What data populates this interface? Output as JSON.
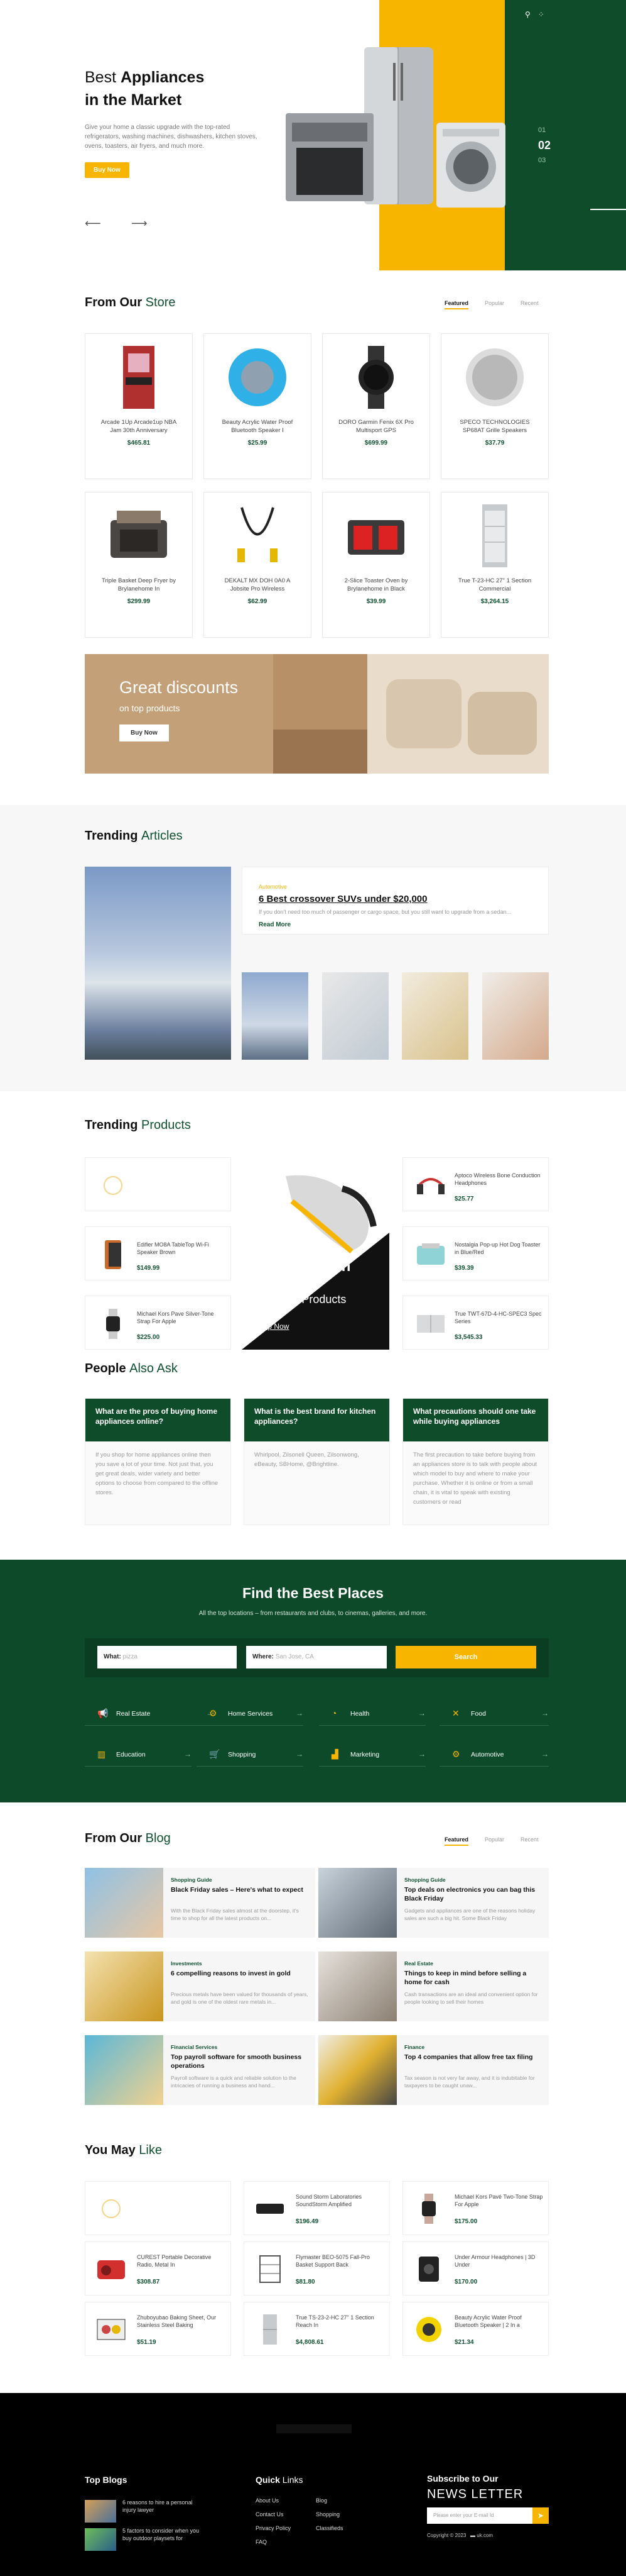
{
  "hero": {
    "title_pre": "Best ",
    "title_bold": "Appliances",
    "title_line2": "in the Market",
    "subtitle": "Give your home a classic upgrade with the top-rated refrigerators, washing machines, dishwashers, kitchen stoves, ovens, toasters, air fryers, and much more.",
    "button": "Buy Now",
    "slide_prev": "01",
    "slide_current": "02",
    "slide_next": "03",
    "colors": {
      "yellow": "#f7b500",
      "green": "#0f4d2a"
    }
  },
  "store": {
    "title_pre": "From Our ",
    "title_accent": "Store",
    "tabs": [
      "Featured",
      "Popular",
      "Recent"
    ],
    "products": [
      {
        "name": "Arcade 1Up Arcade1up NBA Jam 30th Anniversary",
        "price": "$465.81"
      },
      {
        "name": "Beauty Acrylic Water Proof Bluetooth Speaker I",
        "price": "$25.99"
      },
      {
        "name": "DORO Garmin Fenix 6X Pro Multisport GPS",
        "price": "$699.99"
      },
      {
        "name": "SPECO TECHNOLOGIES SP68AT Grille Speakers",
        "price": "$37.79"
      },
      {
        "name": "Triple Basket Deep Fryer by Brylanehome In",
        "price": "$299.99"
      },
      {
        "name": "DEKALT MX DOH 0A0 A Jobsite Pro Wireless",
        "price": "$62.99"
      },
      {
        "name": "2-Slice Toaster Oven by Brylanehome in Black",
        "price": "$39.99"
      },
      {
        "name": "True T-23-HC 27\" 1 Section Commercial",
        "price": "$3,264.15"
      }
    ]
  },
  "banner": {
    "title": "Great discounts",
    "subtitle": "on top products",
    "button": "Buy Now"
  },
  "articles": {
    "title_pre": "Trending ",
    "title_accent": "Articles",
    "category": "Automotive",
    "headline": "6 Best crossover SUVs under $20,000",
    "excerpt": "If you don't need too much of passenger or cargo space, but you still want to upgrade from a sedan...",
    "read_more": "Read More"
  },
  "trending": {
    "title_pre": "Trending ",
    "title_accent": "Products",
    "items": [
      {
        "name": "",
        "price": ""
      },
      {
        "name": "Aptoco Wireless Bone Conduction Headphones",
        "price": "$25.77"
      },
      {
        "name": "Edifier MO8A TableTop Wi-Fi Speaker Brown",
        "price": "$149.99"
      },
      {
        "name": "Nostalgia Pop-up Hot Dog Toaster in Blue/Red",
        "price": "$39.39"
      },
      {
        "name": "Michael Kors Pave Silver-Tone Strap For Apple",
        "price": "$225.00"
      },
      {
        "name": "True TWT-67D-4-HC-SPEC3 Spec Series",
        "price": "$3,545.33"
      }
    ],
    "offer_title": "Best offers in",
    "offer_sub": "Trending Products",
    "offer_link": "Shop Now"
  },
  "faq": {
    "title_pre": "People ",
    "title_accent": "Also Ask",
    "items": [
      {
        "q": "What are the pros of buying home appliances online?",
        "a": "If you shop for home appliances online then you save a lot of your time. Not just that, you get great deals, wider variety and better options to choose from compared to the offline stores."
      },
      {
        "q": "What is the best brand for kitchen appliances?",
        "a": "Whirlpool, Zilsonell Queen, Zilsonwong, eBeauty, SBHome, @Brightline."
      },
      {
        "q": "What precautions should one take while buying appliances",
        "a": "The first precaution to take before buying from an appliances store is to talk with people about which model to buy and where to make your purchase. Whether it is online or from a small chain, it is vital to speak with existing customers or read"
      }
    ]
  },
  "places": {
    "title": "Find the Best Places",
    "subtitle": "All the top locations – from restaurants and clubs, to cinemas, galleries, and more.",
    "what_label": "What:",
    "what_placeholder": "pizza",
    "where_label": "Where:",
    "where_placeholder": "San Jose, CA",
    "search": "Search",
    "categories": [
      {
        "icon": "megaphone-icon",
        "label": "Real Estate"
      },
      {
        "icon": "gear-icon",
        "label": "Home Services"
      },
      {
        "icon": "pie-icon",
        "label": "Health"
      },
      {
        "icon": "cross-icon",
        "label": "Food"
      },
      {
        "icon": "book-icon",
        "label": "Education"
      },
      {
        "icon": "cart-icon",
        "label": "Shopping"
      },
      {
        "icon": "chart-icon",
        "label": "Marketing"
      },
      {
        "icon": "gear-icon",
        "label": "Automotive"
      }
    ]
  },
  "blog": {
    "title_pre": "From Our ",
    "title_accent": "Blog",
    "tabs": [
      "Featured",
      "Popular",
      "Recent"
    ],
    "posts": [
      {
        "cat": "Shopping Guide",
        "title": "Black Friday sales – Here's what to expect",
        "ex": "With the Black Friday sales almost at the doorstep, it's time to shop for all the latest products on..."
      },
      {
        "cat": "Shopping Guide",
        "title": "Top deals on electronics you can bag this Black Friday",
        "ex": "Gadgets and appliances are one of the reasons holiday sales are such a big hit. Some Black Friday"
      },
      {
        "cat": "Investments",
        "title": "6 compelling reasons to invest in gold",
        "ex": "Precious metals have been valued for thousands of years, and gold is one of the oldest rare metals in..."
      },
      {
        "cat": "Real Estate",
        "title": "Things to keep in mind before selling a home for cash",
        "ex": "Cash transactions are an ideal and convenient option for people looking to sell their homes"
      },
      {
        "cat": "Financial Services",
        "title": "Top payroll software for smooth business operations",
        "ex": "Payroll software is a quick and reliable solution to the intricacies of running a business and hand..."
      },
      {
        "cat": "Finance",
        "title": "Top 4 companies that allow free tax filing",
        "ex": "Tax season is not very far away, and it is indubitable for taxpayers to be caught unaw..."
      }
    ]
  },
  "youmay": {
    "title_pre": "You May ",
    "title_accent": "Like",
    "items": [
      {
        "name": "",
        "price": ""
      },
      {
        "name": "Sound Storm Laboratories SoundStorm Amplified",
        "price": "$196.49"
      },
      {
        "name": "Michael Kors Pavé Two-Tone Strap For Apple",
        "price": "$175.00"
      },
      {
        "name": "CUREST Portable Decorative Radio, Metal In",
        "price": "$308.87"
      },
      {
        "name": "Flymaster BEO-5075 Fall-Pro Basket Support Back",
        "price": "$81.80"
      },
      {
        "name": "Under Armour Headphones | 3D Under",
        "price": "$170.00"
      },
      {
        "name": "Zhuboyubao Baking Sheet, Our Stainless Steel Baking",
        "price": "$51.19"
      },
      {
        "name": "True TS-23-2-HC 27\" 1 Section Reach In",
        "price": "$4,808.61"
      },
      {
        "name": "Beauty Acrylic Water Proof Bluetooth Speaker | 2 In a",
        "price": "$21.34"
      }
    ]
  },
  "footer": {
    "top_blogs": "Top Blogs",
    "blog1": "6 reasons to hire a personal injury lawyer",
    "blog2": "5 factors to consider when you buy outdoor playsets for",
    "quick_pre": "Quick ",
    "quick_accent": "Links",
    "links_a": [
      "About Us",
      "Contact Us",
      "Privacy Policy",
      "FAQ"
    ],
    "links_b": [
      "Blog",
      "Shopping",
      "Classifieds"
    ],
    "sub_title": "Subscribe to Our",
    "sub_accent": "NEWS LETTER",
    "email_placeholder": "Please enter your E-mail Id",
    "copyright": "Copyright © 2023",
    "site": "uk.com"
  }
}
